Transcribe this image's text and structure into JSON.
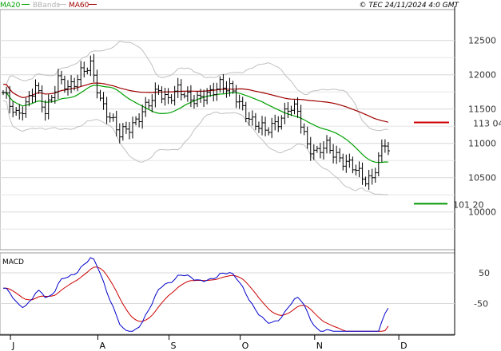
{
  "header": {
    "ma20_label": "MA20",
    "bbands_label": "BBands",
    "ma60_label": "MA60",
    "copyright": "© TEC 24/11/2024 4:0 GMT"
  },
  "macd_label": "MACD",
  "colors": {
    "price": "#000000",
    "ma20": "#00a000",
    "ma60": "#a00000",
    "bbands": "#c0c0c0",
    "grid": "#d8d8d8",
    "resistance": "#cc0000",
    "support": "#009900",
    "macd": "#0000cc",
    "signal": "#cc0000"
  },
  "chart_data": [
    {
      "type": "line",
      "subtype": "ohlc",
      "ylim": [
        9450,
        12950
      ],
      "y_ticks": [
        {
          "value": 12500,
          "label": "12500"
        },
        {
          "value": 12000,
          "label": "12000"
        },
        {
          "value": 11500,
          "label": "11500"
        },
        {
          "value": 11000,
          "label": "11000"
        },
        {
          "value": 10500,
          "label": "10500"
        },
        {
          "value": 10000,
          "label": "10000"
        }
      ],
      "x_ticks": [
        {
          "index": 2,
          "label": "J"
        },
        {
          "index": 29,
          "label": "A"
        },
        {
          "index": 51,
          "label": "S"
        },
        {
          "index": 73,
          "label": "O"
        },
        {
          "index": 96,
          "label": "N"
        },
        {
          "index": 122,
          "label": "D"
        }
      ],
      "levels": [
        {
          "name": "resistance",
          "value": 11304,
          "label": "113 04"
        },
        {
          "name": "support",
          "value": 10120,
          "label": "101 20"
        }
      ]
    },
    {
      "type": "line",
      "ylim": [
        -150,
        115
      ],
      "y_ticks": [
        {
          "value": 50,
          "label": "50"
        },
        {
          "value": -50,
          "label": "-50"
        }
      ]
    }
  ]
}
